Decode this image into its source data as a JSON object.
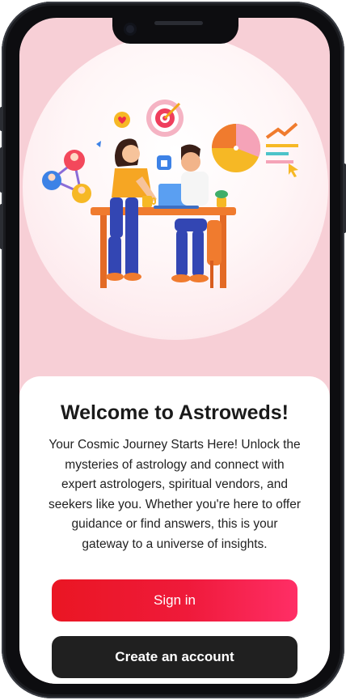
{
  "welcome": {
    "title": "Welcome to Astroweds!",
    "description": "Your Cosmic Journey Starts Here! Unlock the mysteries of astrology and connect with expert astrologers, spiritual vendors, and seekers like you. Whether you're here to offer guidance or find answers, this is your gateway to a universe of insights."
  },
  "actions": {
    "signin_label": "Sign in",
    "create_label": "Create an account"
  },
  "colors": {
    "background_pink": "#f7cfd6",
    "signin_gradient_start": "#ea1623",
    "signin_gradient_end": "#ff2e66",
    "create_button": "#202020"
  },
  "illustration": {
    "icons": [
      "target-icon",
      "heart-icon",
      "thumbs-up-icon",
      "pie-chart-icon",
      "trend-arrow-icon",
      "network-users-icon",
      "cursor-icon",
      "laptop-icon",
      "coffee-mug-icon",
      "plant-icon"
    ]
  }
}
